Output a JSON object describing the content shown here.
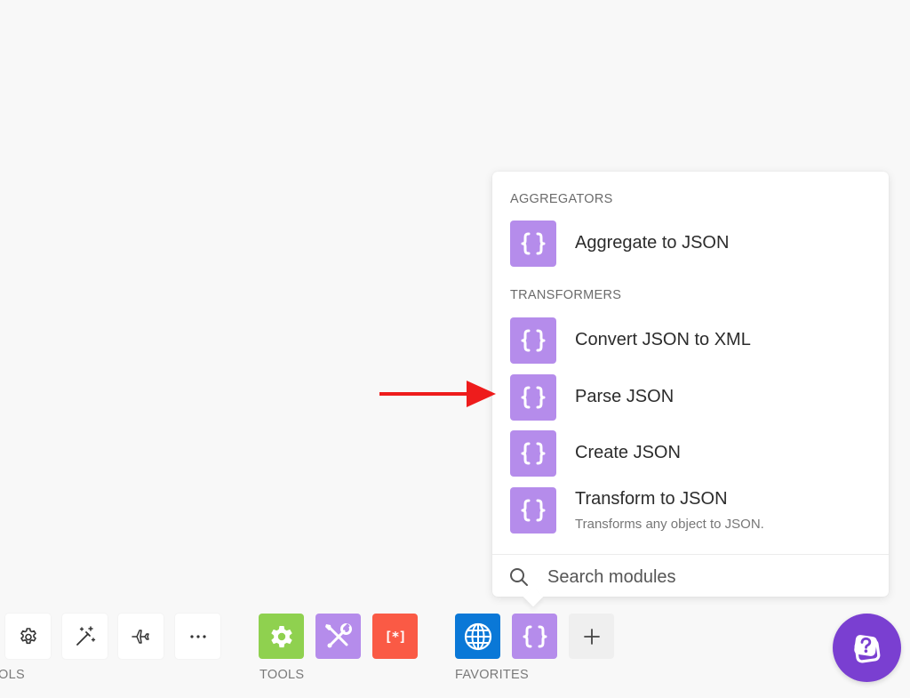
{
  "popup": {
    "sections": [
      {
        "title": "AGGREGATORS",
        "items": [
          {
            "label": "Aggregate to JSON"
          }
        ]
      },
      {
        "title": "TRANSFORMERS",
        "items": [
          {
            "label": "Convert JSON to XML"
          },
          {
            "label": "Parse JSON"
          },
          {
            "label": "Create JSON"
          },
          {
            "label": "Transform to JSON",
            "description": "Transforms any object to JSON."
          }
        ]
      }
    ],
    "search": {
      "placeholder": "Search modules"
    }
  },
  "toolbar": {
    "groups": [
      {
        "label": "OLS"
      },
      {
        "label": "TOOLS"
      },
      {
        "label": "FAVORITES"
      }
    ],
    "tools_text_icon": "[*]"
  },
  "colors": {
    "module_purple": "#b58ceb",
    "tools_green": "#8fd14f",
    "text_parser_orange": "#fa5a45",
    "http_blue": "#0a78d7",
    "help_purple": "#7a3fd1",
    "arrow_red": "#ee1c1c"
  },
  "icons": [
    "curly-braces-icon",
    "search-icon",
    "gear-icon",
    "magic-wand-icon",
    "airplane-icon",
    "more-icon",
    "tools-gear-icon",
    "tools-wrench-icon",
    "text-parser-icon",
    "globe-icon",
    "plus-icon",
    "help-icon",
    "arrow-icon"
  ]
}
